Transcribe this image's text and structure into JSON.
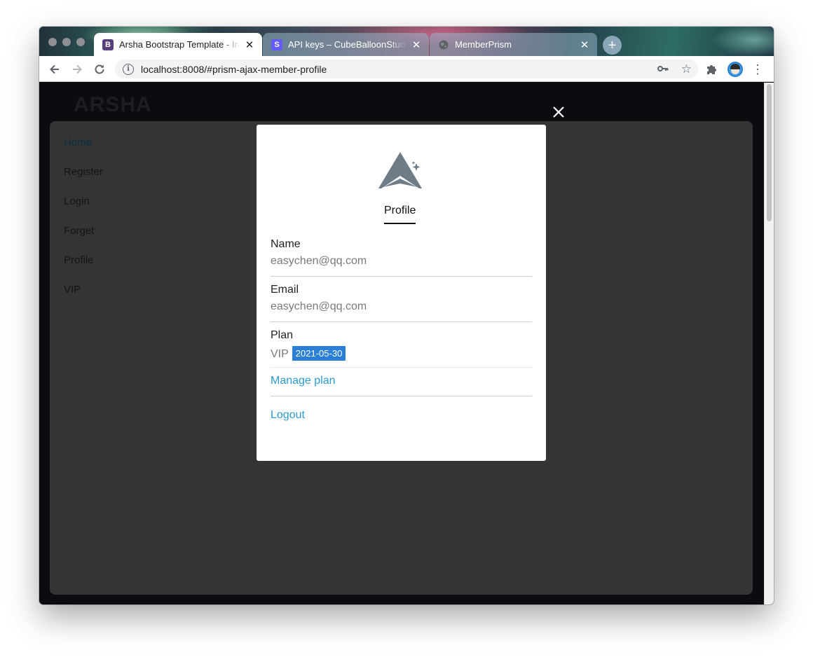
{
  "browser": {
    "tabs": [
      {
        "title": "Arsha Bootstrap Template - Index",
        "favicon": "B",
        "favicon_color": "#563d7c"
      },
      {
        "title": "API keys – CubeBalloonStudio – Stripe",
        "favicon": "S",
        "favicon_color": "#635bff"
      },
      {
        "title": "MemberPrism",
        "favicon": "globe-icon",
        "favicon_color": "#5f6368"
      }
    ],
    "url": "localhost:8008/#prism-ajax-member-profile"
  },
  "site": {
    "brand": "ARSHA",
    "nav": [
      "Home",
      "Register",
      "Login",
      "Forget",
      "Profile",
      "VIP"
    ]
  },
  "modal": {
    "tab_label": "Profile",
    "name_label": "Name",
    "name_value": "easychen@qq.com",
    "email_label": "Email",
    "email_value": "easychen@qq.com",
    "plan_label": "Plan",
    "plan_value": "VIP",
    "plan_expiry": "2021-05-30",
    "manage_plan": "Manage plan",
    "logout": "Logout"
  },
  "colors": {
    "accent_link": "#2b9ad1",
    "badge": "#2b7fd6",
    "overlay_panel": "#343434"
  }
}
